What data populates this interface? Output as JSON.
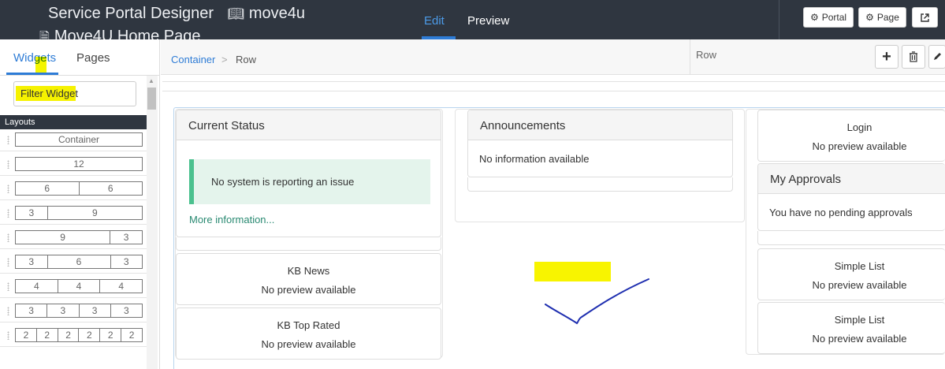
{
  "header": {
    "app_title": "Service Portal Designer",
    "portal_name": "move4u",
    "page_name": "Move4U Home Page",
    "tabs": [
      {
        "label": "Edit",
        "active": true
      },
      {
        "label": "Preview",
        "active": false
      }
    ],
    "buttons": {
      "portal": "Portal",
      "page": "Page"
    }
  },
  "left_panel": {
    "tabs": [
      {
        "label": "Widgets",
        "active": true
      },
      {
        "label": "Pages",
        "active": false
      }
    ],
    "filter_placeholder": "Filter Widget",
    "layouts_header": "Layouts",
    "layouts": [
      [
        "Container"
      ],
      [
        "12"
      ],
      [
        "6",
        "6"
      ],
      [
        "3",
        "9"
      ],
      [
        "9",
        "3"
      ],
      [
        "3",
        "6",
        "3"
      ],
      [
        "4",
        "4",
        "4"
      ],
      [
        "3",
        "3",
        "3",
        "3"
      ],
      [
        "2",
        "2",
        "2",
        "2",
        "2",
        "2"
      ]
    ]
  },
  "breadcrumb": {
    "container": "Container",
    "separator": ">",
    "row": "Row",
    "selected_label": "Row"
  },
  "canvas": {
    "current_status": {
      "title": "Current Status",
      "alert": "No system is reporting an issue",
      "link": "More information..."
    },
    "kb_news": {
      "title": "KB News",
      "sub": "No preview available"
    },
    "kb_top_rated": {
      "title": "KB Top Rated",
      "sub": "No preview available"
    },
    "announcements": {
      "title": "Announcements",
      "text": "No information available"
    },
    "login": {
      "title": "Login",
      "sub": "No preview available"
    },
    "my_approvals": {
      "title": "My Approvals",
      "text": "You have no pending approvals"
    },
    "simple_list_1": {
      "title": "Simple List",
      "sub": "No preview available"
    },
    "simple_list_2": {
      "title": "Simple List",
      "sub": "No preview available"
    }
  },
  "colors": {
    "topbar": "#2f3640",
    "accent": "#2e7cd6",
    "alert_bg": "#e4f4ec",
    "alert_border": "#4ac18e",
    "highlight": "#f6f200"
  }
}
